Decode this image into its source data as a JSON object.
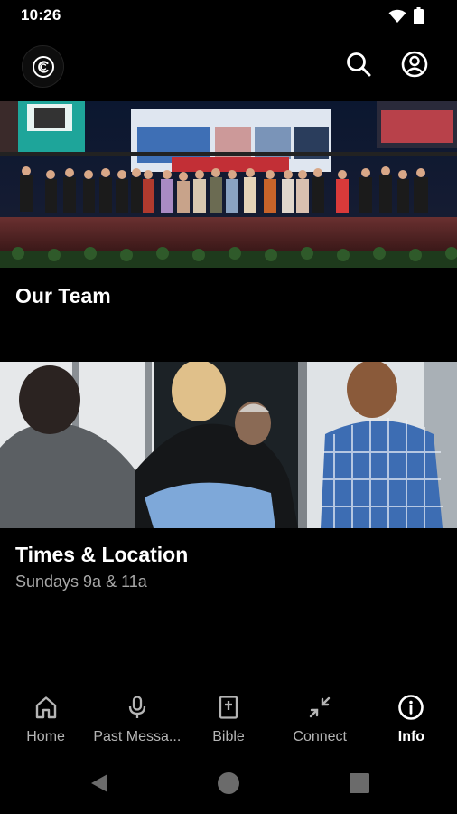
{
  "status_bar": {
    "time": "10:26"
  },
  "header": {
    "logo_icon": "church-logo-icon",
    "search_icon": "search-icon",
    "account_icon": "account-icon"
  },
  "cards": [
    {
      "title": "Our Team",
      "subtitle": "",
      "image": "stage-group-photo"
    },
    {
      "title": "Times & Location",
      "subtitle": "Sundays 9a & 11a",
      "image": "lobby-hug-photo"
    }
  ],
  "tabs": [
    {
      "label": "Home",
      "icon": "home-icon",
      "active": false
    },
    {
      "label": "Past Messa...",
      "icon": "microphone-icon",
      "active": false
    },
    {
      "label": "Bible",
      "icon": "bible-icon",
      "active": false
    },
    {
      "label": "Connect",
      "icon": "connect-icon",
      "active": false
    },
    {
      "label": "Info",
      "icon": "info-icon",
      "active": true
    }
  ],
  "colors": {
    "background": "#000000",
    "text": "#ffffff",
    "muted": "#a8a8a8",
    "tab_inactive": "#b5b5b5"
  }
}
